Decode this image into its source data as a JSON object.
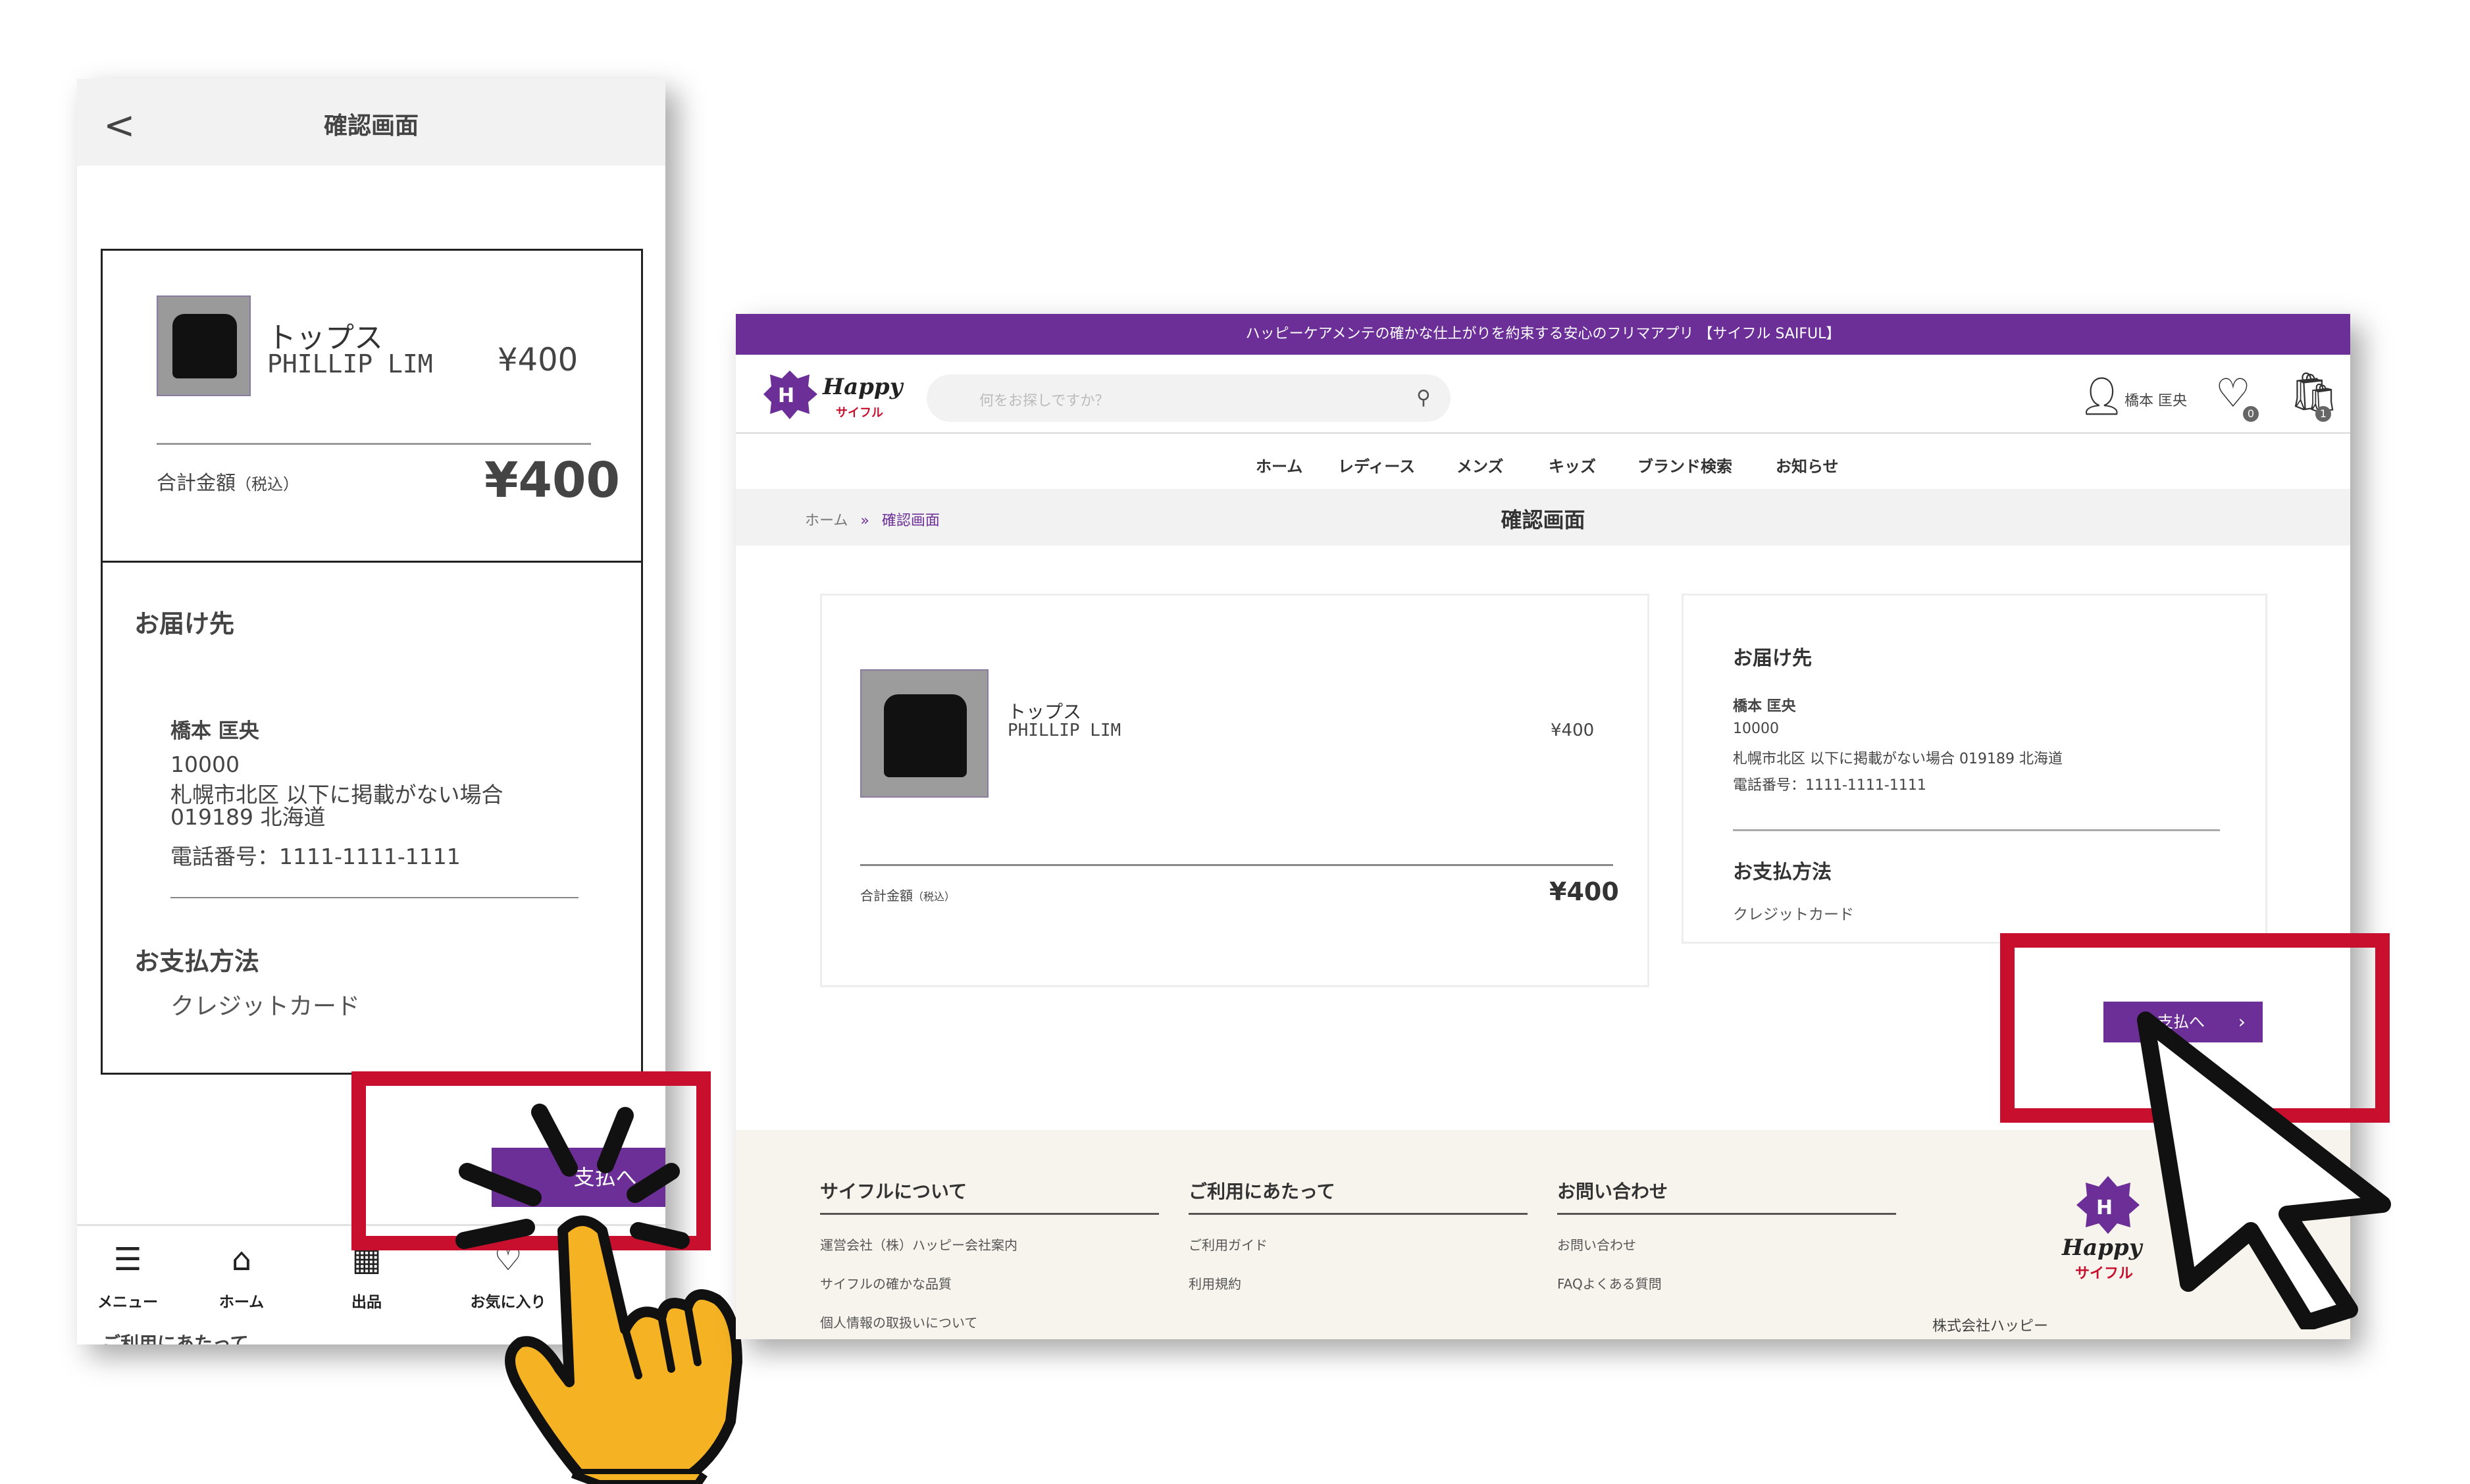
{
  "mobile": {
    "header": {
      "title": "確認画面",
      "back": "<"
    },
    "product": {
      "name": "トップス",
      "brand": "PHILLIP LIM",
      "price": "¥400"
    },
    "total": {
      "label": "合計金額",
      "tax_note": "（税込）",
      "value": "¥400"
    },
    "shipping": {
      "title": "お届け先",
      "name": "橋本 匡央",
      "postal": "10000",
      "address_line1": "札幌市北区 以下に掲載がない場合",
      "address_line2": "019189 北海道",
      "phone": "電話番号：1111-1111-1111"
    },
    "payment": {
      "title": "お支払方法",
      "method": "クレジットカード"
    },
    "pay_button": "支払へ",
    "bottom_nav": [
      {
        "label": "メニュー",
        "icon": "menu-icon"
      },
      {
        "label": "ホーム",
        "icon": "home-icon"
      },
      {
        "label": "出品",
        "icon": "gift-icon"
      },
      {
        "label": "お気に入り",
        "icon": "heart-icon"
      }
    ],
    "below_fold": "ご利用にあたって"
  },
  "desktop": {
    "banner": "ハッピーケアメンテの確かな仕上がりを約束する安心のフリマアプリ 【サイフル SAIFUL】",
    "logo": {
      "text": "Happy",
      "sub": "サイフル"
    },
    "search": {
      "placeholder": "何をお探しですか？"
    },
    "user": {
      "name": "橋本 匡央"
    },
    "favorites_count": "0",
    "cart_count": "1",
    "nav": [
      "ホーム",
      "レディース",
      "メンズ",
      "キッズ",
      "ブランド検索",
      "お知らせ"
    ],
    "breadcrumb": {
      "home": "ホーム",
      "sep": "»",
      "current": "確認画面"
    },
    "page_title": "確認画面",
    "product": {
      "name": "トップス",
      "brand": "PHILLIP LIM",
      "price": "¥400"
    },
    "total": {
      "label": "合計金額",
      "tax_note": "（税込）",
      "value": "¥400"
    },
    "shipping": {
      "title": "お届け先",
      "name": "橋本 匡央",
      "postal": "10000",
      "address": "札幌市北区 以下に掲載がない場合 019189 北海道",
      "phone": "電話番号：1111-1111-1111"
    },
    "payment": {
      "title": "お支払方法",
      "method": "クレジットカード"
    },
    "pay_button": "支払へ",
    "footer": {
      "columns": [
        {
          "title": "サイフルについて",
          "links": [
            "運営会社（株）ハッピー会社案内",
            "サイフルの確かな品質",
            "個人情報の取扱いについて"
          ]
        },
        {
          "title": "ご利用にあたって",
          "links": [
            "ご利用ガイド",
            "利用規約"
          ]
        },
        {
          "title": "お問い合わせ",
          "links": [
            "お問い合わせ",
            "FAQよくある質問"
          ]
        }
      ],
      "logo_text": "Happy",
      "logo_sub": "サイフル",
      "company": "株式会社ハッピー"
    }
  },
  "colors": {
    "brand_purple": "#6c2f97",
    "highlight_red": "#c8102e",
    "hand_yellow": "#f5b324"
  }
}
